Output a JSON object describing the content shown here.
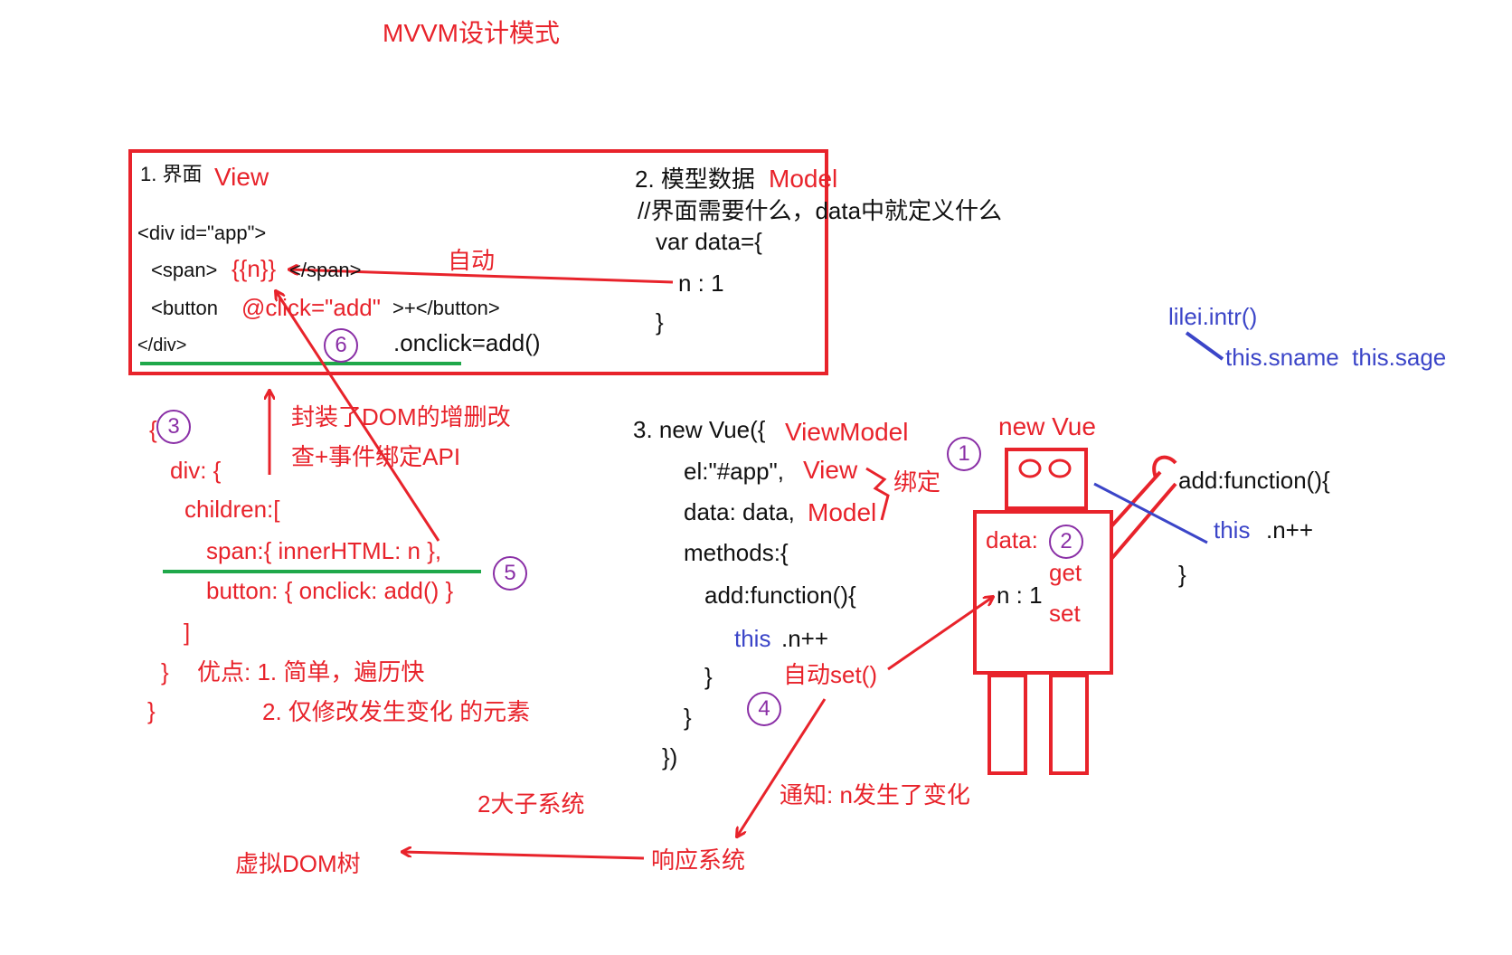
{
  "title": "MVVM设计模式",
  "view": {
    "heading_num": "1. 界面",
    "heading": "View",
    "line1": "<div id=\"app\">",
    "line2_a": "<span>",
    "line2_b": "{{n}}",
    "line2_c": "</span>",
    "line3_a": "<button ",
    "line3_b": "@click=\"add\"",
    "line3_c": ">+</button>",
    "line4": "</div>",
    "onclick": ".onclick=add()",
    "auto": "自动"
  },
  "model": {
    "heading_num": "2. 模型数据",
    "heading": "Model",
    "comment": "//界面需要什么，data中就定义什么",
    "var_line": "var data={",
    "n_line": "n : 1",
    "close": "}"
  },
  "dom_api": {
    "line1": "封装了DOM的增删改",
    "line2": "查+事件绑定API"
  },
  "vdom_tree": {
    "open": "{",
    "div": "div: {",
    "children": "children:[",
    "span": "span:{ innerHTML: n },",
    "button": "button: { onclick: add() }",
    "bracket_close": "]",
    "div_close": "}",
    "outer_close": "}",
    "pros_1": "优点: 1. 简单，遍历快",
    "pros_2": "2. 仅修改发生变化 的元素"
  },
  "vm": {
    "heading_num": "3. new Vue({",
    "heading": "ViewModel",
    "el": "el:\"#app\",",
    "el_view": "View",
    "bind": "绑定",
    "data": "data: data,",
    "data_model": "Model",
    "methods": "methods:{",
    "add_fn": "add:function(){",
    "this_kw": "this",
    "this_rest": ".n++",
    "fn_close": "}",
    "methods_close": "}",
    "vue_close": "})",
    "auto_set": "自动set()"
  },
  "robot": {
    "label": "new Vue",
    "data_label": "data:",
    "n_label": "n : 1",
    "get": "get",
    "set": "set",
    "add_fn": "add:function(){",
    "this_kw": "this",
    "this_rest": ".n++",
    "close": "}"
  },
  "lilei": {
    "call": "lilei.intr()",
    "members": "this.sname  this.sage"
  },
  "bottom": {
    "notify": "通知: n发生了变化",
    "subsystems": "2大子系统",
    "reactive": "响应系统",
    "vdom": "虚拟DOM树"
  },
  "steps": [
    "1",
    "2",
    "3",
    "4",
    "5",
    "6"
  ],
  "colors": {
    "red": "#e8232b",
    "blue": "#3b45c8",
    "green": "#1fa84a",
    "purple": "#8a2fa6",
    "black": "#111111"
  }
}
